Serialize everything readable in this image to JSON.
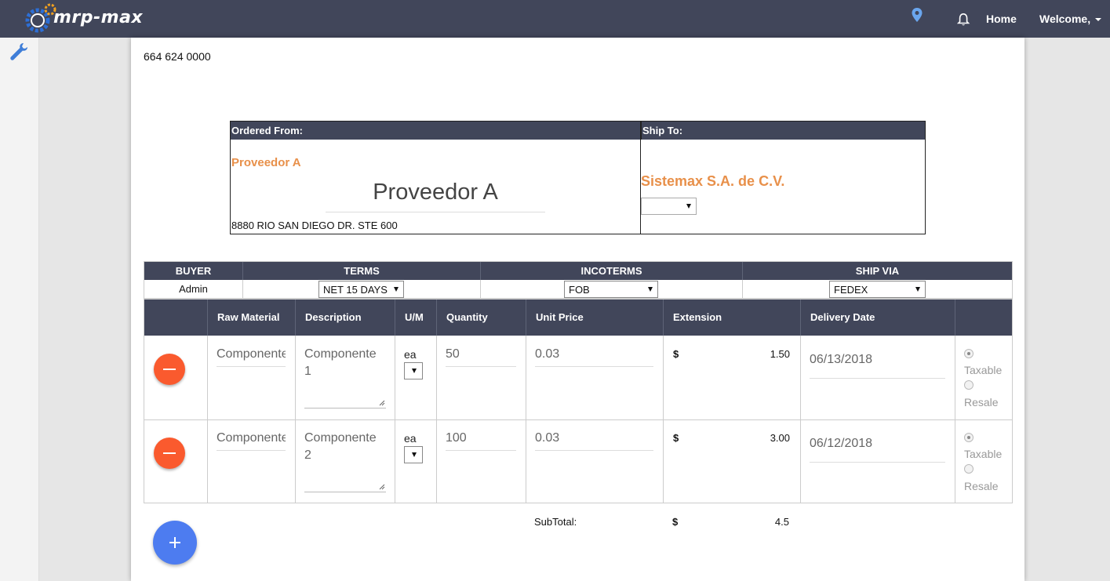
{
  "header": {
    "logo_text": "mrp-max",
    "home_label": "Home",
    "welcome_label": "Welcome,"
  },
  "company": {
    "phone": "664 624 0000"
  },
  "addresses": {
    "ordered_from_label": "Ordered From:",
    "ship_to_label": "Ship To:",
    "vendor_link": "Proveedor A",
    "vendor_name": "Proveedor A",
    "vendor_address": "8880 RIO SAN DIEGO DR. STE 600",
    "ship_to_name": "Sistemax S.A. de C.V.",
    "ship_to_select": ""
  },
  "info": {
    "headers": [
      "BUYER",
      "TERMS",
      "INCOTERMS",
      "SHIP VIA"
    ],
    "buyer": "Admin",
    "terms": "NET 15 DAYS",
    "incoterms": "FOB",
    "ship_via": "FEDEX"
  },
  "items_table": {
    "headers": [
      "Raw Material",
      "Description",
      "U/M",
      "Quantity",
      "Unit Price",
      "Extension",
      "Delivery Date"
    ],
    "rows": [
      {
        "raw_material": "Componente",
        "description_line1": "Componente",
        "description_line2": "1",
        "um": "ea",
        "quantity": "50",
        "unit_price": "0.03",
        "currency": "$",
        "extension": "1.50",
        "delivery_date": "06/13/2018",
        "taxable_label": "Taxable",
        "resale_label": "Resale"
      },
      {
        "raw_material": "Componente",
        "description_line1": "Componente",
        "description_line2": "2",
        "um": "ea",
        "quantity": "100",
        "unit_price": "0.03",
        "currency": "$",
        "extension": "3.00",
        "delivery_date": "06/12/2018",
        "taxable_label": "Taxable",
        "resale_label": "Resale"
      }
    ]
  },
  "subtotal": {
    "label": "SubTotal:",
    "currency": "$",
    "value": "4.5"
  },
  "colors": {
    "header_bg": "#41465a",
    "accent_orange": "#e8904a",
    "remove_button": "#fa5a2e",
    "add_button": "#4d7cf0"
  },
  "icons": [
    "gear-logo-icon",
    "map-pin-icon",
    "bell-icon",
    "wrench-icon",
    "minus-icon",
    "plus-icon",
    "resize-handle-icon"
  ]
}
